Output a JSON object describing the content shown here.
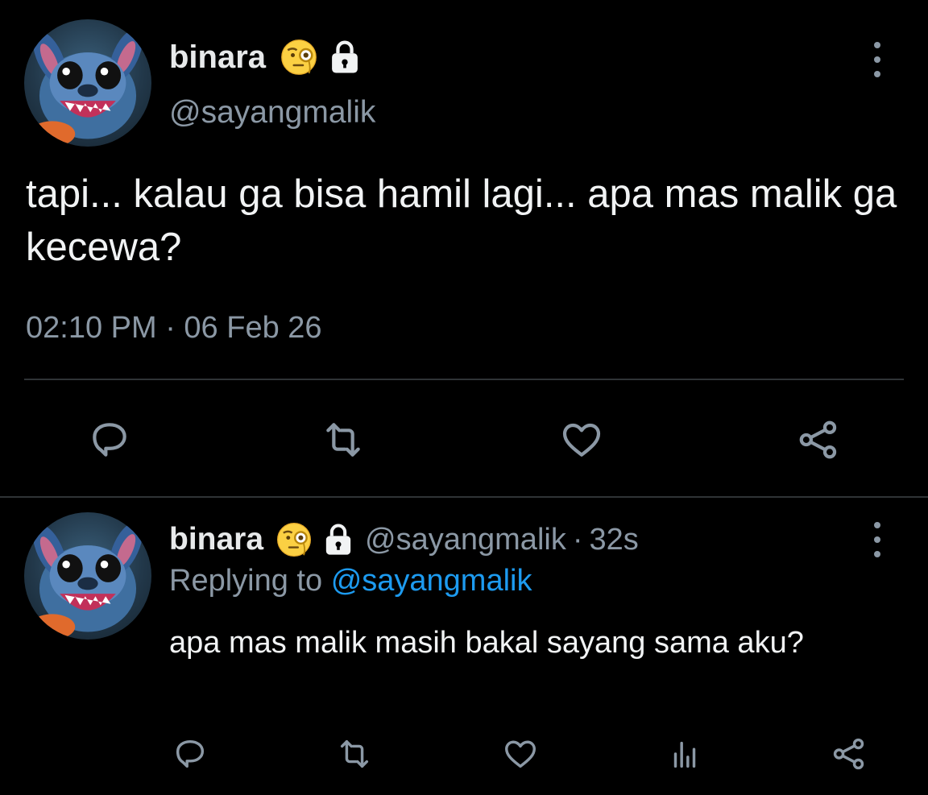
{
  "main_tweet": {
    "display_name": "binara",
    "handle": "@sayangmalik",
    "name_emoji_icon": "face-with-monocle-icon",
    "protected_icon": "lock-icon",
    "avatar_icon": "stitch-avatar",
    "text": "tapi... kalau ga bisa hamil lagi... apa mas malik ga kecewa?",
    "timestamp": "02:10 PM · 06 Feb 26",
    "actions": [
      "reply-icon",
      "retweet-icon",
      "like-icon",
      "share-icon"
    ]
  },
  "reply_tweet": {
    "display_name": "binara",
    "handle": "@sayangmalik",
    "separator": "·",
    "age": "32s",
    "replying_prefix": "Replying to",
    "replying_handle": "@sayangmalik",
    "text": "apa mas malik masih bakal sayang sama aku?",
    "actions": [
      "reply-icon",
      "retweet-icon",
      "like-icon",
      "analytics-icon",
      "share-icon"
    ]
  },
  "colors": {
    "background": "#000000",
    "primary_text": "#e7e9ea",
    "secondary_text": "#8b98a5",
    "link": "#1d9bf0",
    "divider": "#2f3336"
  }
}
